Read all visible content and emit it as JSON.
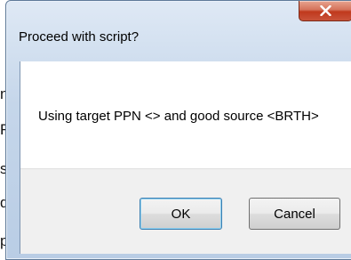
{
  "dialog": {
    "title": "Proceed with script?",
    "message": "Using target PPN <> and good source <BRTH>",
    "close_icon": "close-icon",
    "buttons": {
      "ok_label": "OK",
      "cancel_label": "Cancel"
    }
  },
  "background_fragments": [
    "n",
    "Re",
    "s",
    "d",
    "p"
  ]
}
